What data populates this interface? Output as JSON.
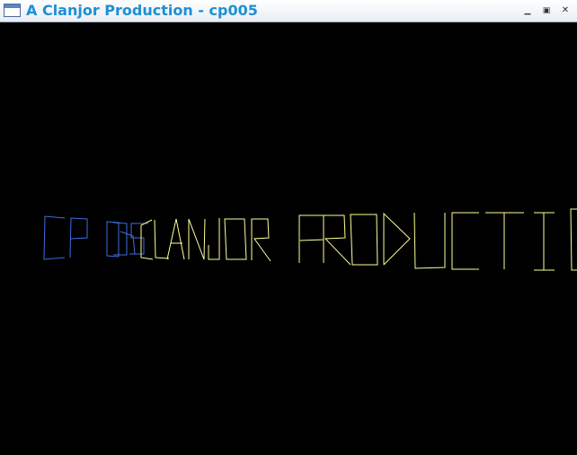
{
  "window": {
    "title": "A Clanjor Production - cp005",
    "icon": "window-app-icon",
    "buttons": {
      "minimize": "minimize-icon",
      "maximize": "restore-icon",
      "close": "close-icon"
    },
    "minimize_label": "▁",
    "maximize_label": "▣",
    "close_label": "✕"
  },
  "scene": {
    "background": "#000000",
    "logo_text": {
      "blue_part": "CP 005",
      "yellow_part": "CLANJOR PRODUCTION",
      "blue_color": "#3f6fe0",
      "yellow_color": "#ffff99"
    }
  }
}
